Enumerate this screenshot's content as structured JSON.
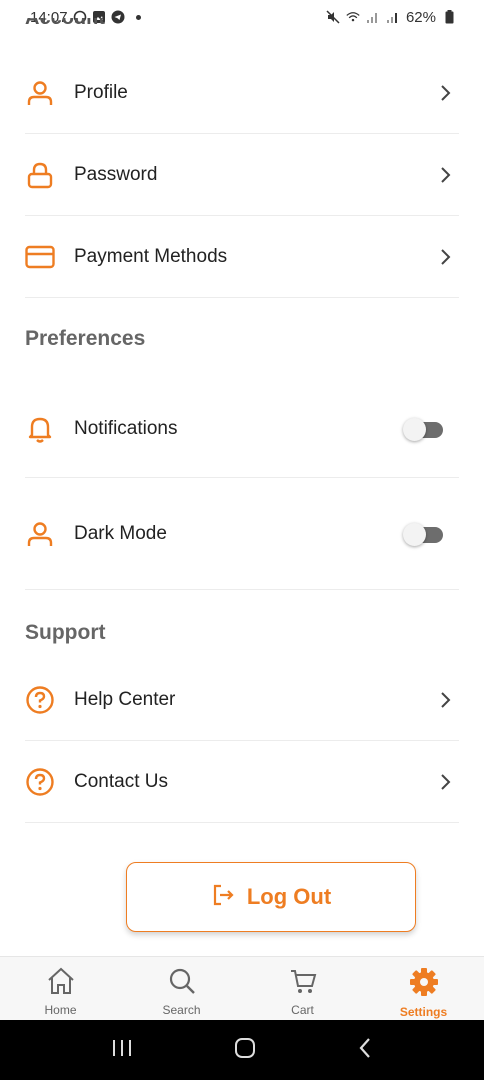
{
  "status_bar": {
    "time": "14:07",
    "battery": "62%"
  },
  "account": {
    "heading": "Account",
    "items": [
      {
        "label": "Profile",
        "icon": "user-icon"
      },
      {
        "label": "Password",
        "icon": "lock-icon"
      },
      {
        "label": "Payment Methods",
        "icon": "credit-card-icon"
      }
    ]
  },
  "preferences": {
    "heading": "Preferences",
    "items": [
      {
        "label": "Notifications",
        "icon": "bell-icon",
        "enabled": false
      },
      {
        "label": "Dark Mode",
        "icon": "user-icon",
        "enabled": false
      }
    ]
  },
  "support": {
    "heading": "Support",
    "items": [
      {
        "label": "Help Center",
        "icon": "question-circle-icon"
      },
      {
        "label": "Contact Us",
        "icon": "question-circle-icon"
      }
    ]
  },
  "logout": {
    "label": "Log Out",
    "icon": "logout-icon"
  },
  "bottom_nav": {
    "items": [
      {
        "label": "Home",
        "icon": "home-icon",
        "active": false
      },
      {
        "label": "Search",
        "icon": "search-icon",
        "active": false
      },
      {
        "label": "Cart",
        "icon": "cart-icon",
        "active": false
      },
      {
        "label": "Settings",
        "icon": "gear-icon",
        "active": true
      }
    ]
  },
  "colors": {
    "accent": "#ee7d22",
    "text": "#222222",
    "section": "#666666"
  }
}
